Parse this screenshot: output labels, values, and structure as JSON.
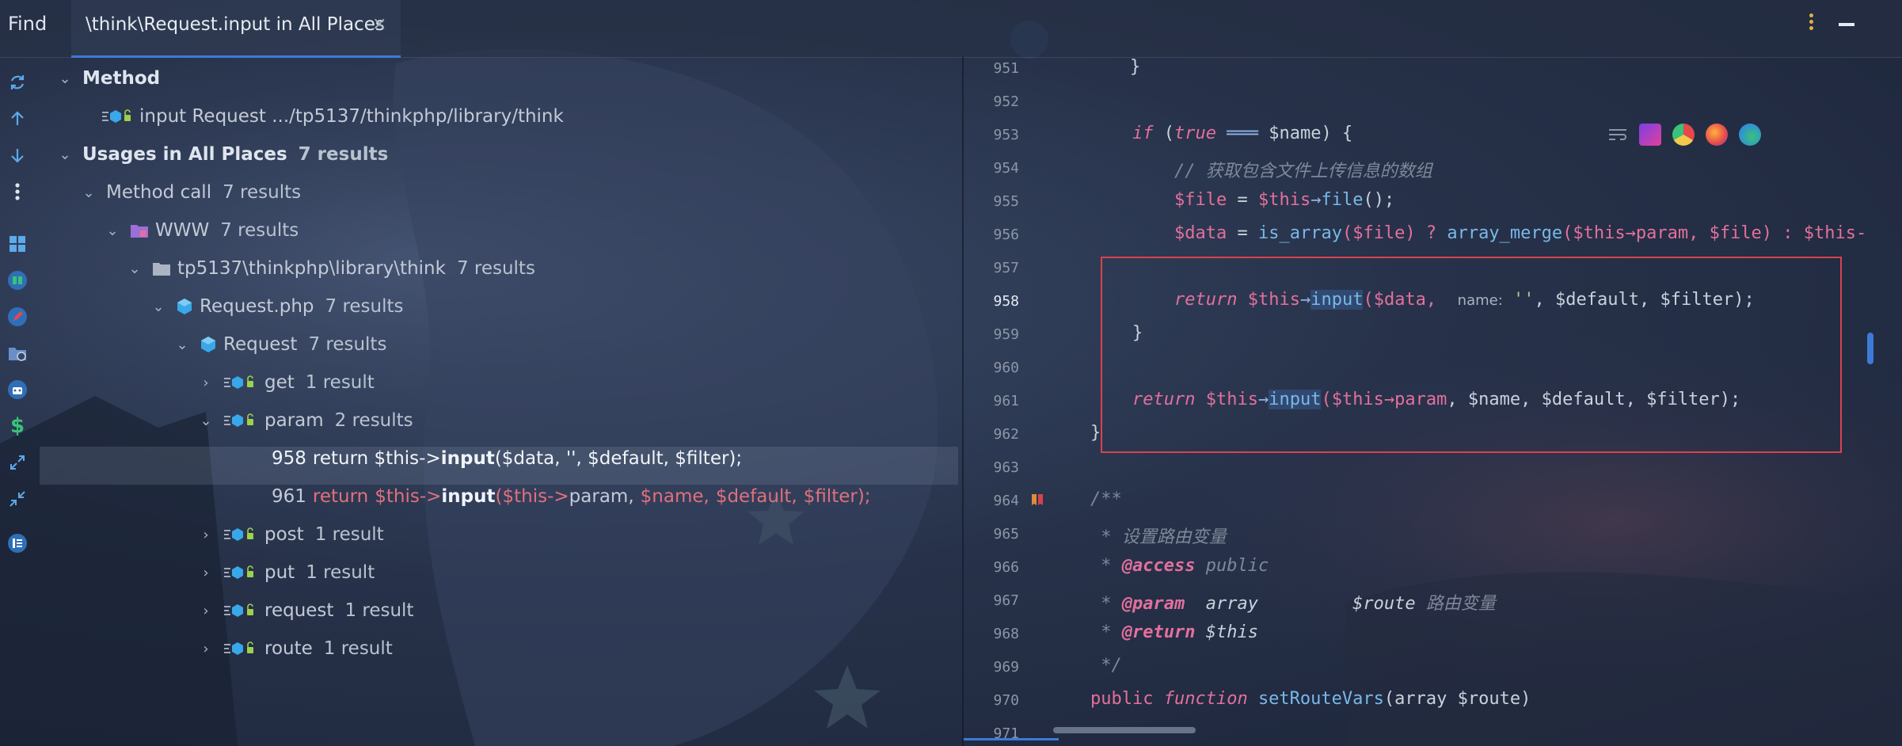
{
  "header": {
    "find_label": "Find",
    "tab_title": "\\think\\Request.input in All Places",
    "tab_close": "×"
  },
  "tree": {
    "method_header": "Method",
    "method_item": "input Request .../tp5137/thinkphp/library/think",
    "usages_header": "Usages in All Places",
    "usages_count": "7 results",
    "method_call": "Method call",
    "method_call_count": "7 results",
    "www": "WWW",
    "www_count": "7 results",
    "path": "tp5137\\thinkphp\\library\\think",
    "path_count": "7 results",
    "file": "Request.php",
    "file_count": "7 results",
    "class": "Request",
    "class_count": "7 results",
    "methods": [
      {
        "name": "get",
        "count": "1 result"
      },
      {
        "name": "param",
        "count": "2 results"
      },
      {
        "name": "post",
        "count": "1 result"
      },
      {
        "name": "put",
        "count": "1 result"
      },
      {
        "name": "request",
        "count": "1 result"
      },
      {
        "name": "route",
        "count": "1 result"
      }
    ],
    "usage1": {
      "line": "958",
      "pre": "return $this->",
      "fn": "input",
      "post": "($data, '', $default, $filter);"
    },
    "usage2": {
      "line": "961",
      "ret": "return",
      "this": "$this->",
      "fn": "input",
      "a1": "($this->",
      "a2": "param,",
      "a3": "$name,",
      "a4": "$default,",
      "a5": "$filter",
      "a6": ");"
    }
  },
  "editor": {
    "line_numbers": [
      "951",
      "952",
      "953",
      "954",
      "955",
      "956",
      "957",
      "958",
      "959",
      "960",
      "961",
      "962",
      "963",
      "964",
      "965",
      "966",
      "967",
      "968",
      "969",
      "970",
      "971"
    ],
    "hint_name": "name:",
    "c953_if": "if",
    "c953_true": "true",
    "c953_rest": "$name) {",
    "c954": "// 获取包含文件上传信息的数组",
    "c955a": "$file",
    "c955b": " = ",
    "c955c": "$this",
    "c955d": "→",
    "c955e": "file",
    "c955f": "();",
    "c956a": "$data",
    "c956b": " = ",
    "c956c": "is_array",
    "c956d": "($file) ? ",
    "c956e": "array_merge",
    "c956f": "($this",
    "c956g": "→param",
    "c956h": ", $file) : $this-",
    "c958_return": "return",
    "c958_this": "$this",
    "c958_arrow": "→",
    "c958_fn": "input",
    "c958_a": "($data,",
    "c958_str": "''",
    "c958_b": ", $default, $filter);",
    "c961_return": "return",
    "c961_this": "$this",
    "c961_arrow": "→",
    "c961_fn": "input",
    "c961_a": "($this",
    "c961_b": "→param",
    "c961_c": ", $name, $default, $filter);",
    "c951": "}",
    "c959": "}",
    "c962": "}",
    "c964": "/**",
    "c965": " * 设置路由变量",
    "c966_tag": "@access",
    "c966_val": " public",
    "c967_tag": "@param",
    "c967_type": "  array",
    "c967_var": "         $route",
    "c967_desc": " 路由变量",
    "c968_tag": "@return",
    "c968_val": " $this",
    "c969": " */",
    "c970_public": "public",
    "c970_function": " function ",
    "c970_name": "setRouteVars",
    "c970_rest": "(array $route)"
  },
  "colors": {
    "accent": "#3d7ad8",
    "highlight_box": "#d8434e",
    "keyword": "#e2709c"
  }
}
